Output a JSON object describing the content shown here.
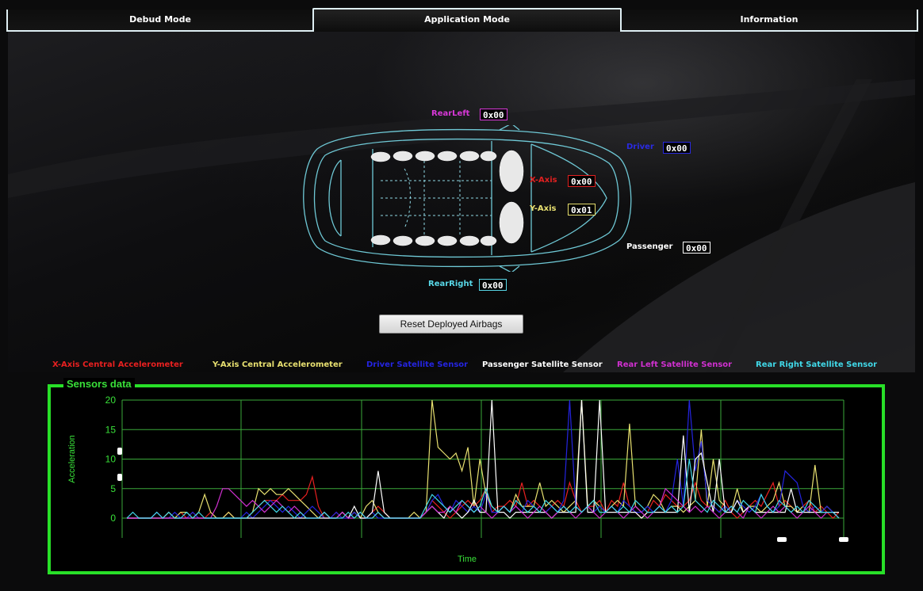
{
  "tabs": [
    {
      "label": "Debud Mode",
      "active": false
    },
    {
      "label": "Application Mode",
      "active": true
    },
    {
      "label": "Information",
      "active": false
    }
  ],
  "sensors": {
    "rear_left": {
      "label": "RearLeft",
      "value": "0x00",
      "color": "#d838d8"
    },
    "driver": {
      "label": "Driver",
      "value": "0x00",
      "color": "#2a2ae0"
    },
    "x_axis": {
      "label": "X-Axis",
      "value": "0x00",
      "color": "#e02020"
    },
    "y_axis": {
      "label": "Y-Axis",
      "value": "0x01",
      "color": "#e8e070"
    },
    "passenger": {
      "label": "Passenger",
      "value": "0x00",
      "color": "#ffffff"
    },
    "rear_right": {
      "label": "RearRight",
      "value": "0x00",
      "color": "#58d8e8"
    }
  },
  "reset_button_label": "Reset Deployed Airbags",
  "chart_title": "Sensors data",
  "chart_data": {
    "type": "line",
    "ylabel": "Acceleration",
    "xlabel": "Time",
    "ylim": [
      0,
      20
    ],
    "yticks": [
      0,
      5,
      10,
      15,
      20
    ],
    "grid": true,
    "legend": "top",
    "series": [
      {
        "name": "X-Axis Central Accelerometer",
        "color": "#e82020",
        "values": [
          0,
          0,
          0,
          0,
          0,
          1,
          0,
          1,
          0,
          1,
          0,
          1,
          0,
          0,
          1,
          0,
          0,
          1,
          0,
          0,
          0,
          1,
          2,
          3,
          3,
          3,
          4,
          3,
          3,
          3,
          4,
          7,
          2,
          0,
          0,
          1,
          0,
          0,
          1,
          0,
          0,
          1,
          2,
          1,
          0,
          0,
          0,
          0,
          0,
          0,
          1,
          3,
          2,
          1,
          0,
          1,
          2,
          3,
          2,
          3,
          5,
          1,
          2,
          2,
          3,
          2,
          6,
          2,
          3,
          2,
          1,
          2,
          3,
          2,
          6,
          3,
          1,
          2,
          2,
          3,
          1,
          3,
          2,
          6,
          2,
          1,
          0,
          1,
          3,
          2,
          4,
          3,
          2,
          2,
          3,
          6,
          3,
          2,
          2,
          1,
          3,
          1,
          0,
          1,
          2,
          3,
          2,
          4,
          6,
          2,
          3,
          2,
          1,
          2,
          3,
          1,
          2,
          1,
          0,
          1
        ]
      },
      {
        "name": "Y-Axis Central Accelerometer",
        "color": "#e8e070",
        "values": [
          0,
          0,
          0,
          0,
          0,
          0,
          0,
          1,
          0,
          1,
          1,
          0,
          1,
          4,
          1,
          0,
          0,
          1,
          0,
          0,
          0,
          1,
          5,
          4,
          5,
          4,
          4,
          5,
          4,
          3,
          2,
          1,
          0,
          1,
          0,
          0,
          1,
          0,
          1,
          0,
          2,
          3,
          1,
          0,
          0,
          0,
          0,
          0,
          1,
          0,
          1,
          20,
          12,
          11,
          10,
          11,
          8,
          12,
          2,
          10,
          4,
          2,
          1,
          2,
          1,
          4,
          2,
          2,
          2,
          6,
          2,
          3,
          2,
          1,
          2,
          3,
          20,
          2,
          3,
          2,
          1,
          2,
          3,
          2,
          16,
          2,
          1,
          2,
          4,
          3,
          1,
          2,
          2,
          1,
          2,
          3,
          15,
          2,
          10,
          3,
          2,
          1,
          5,
          1,
          2,
          2,
          1,
          2,
          3,
          6,
          2,
          2,
          1,
          2,
          1,
          9,
          1,
          2,
          1,
          0
        ]
      },
      {
        "name": "Driver Satellite Sensor",
        "color": "#2424e0",
        "values": [
          0,
          0,
          0,
          0,
          0,
          1,
          0,
          0,
          1,
          0,
          0,
          1,
          0,
          0,
          0,
          0,
          0,
          0,
          0,
          0,
          1,
          0,
          1,
          2,
          3,
          2,
          1,
          2,
          1,
          0,
          1,
          2,
          1,
          0,
          0,
          1,
          0,
          0,
          1,
          0,
          0,
          1,
          0,
          0,
          0,
          0,
          0,
          0,
          0,
          0,
          1,
          3,
          4,
          2,
          1,
          3,
          2,
          1,
          2,
          1,
          4,
          1,
          1,
          2,
          1,
          2,
          1,
          3,
          2,
          1,
          1,
          2,
          1,
          3,
          20,
          2,
          1,
          2,
          1,
          2,
          1,
          2,
          1,
          3,
          2,
          1,
          1,
          2,
          1,
          2,
          1,
          3,
          10,
          2,
          20,
          8,
          13,
          3,
          2,
          1,
          2,
          1,
          3,
          2,
          1,
          2,
          4,
          2,
          1,
          2,
          8,
          7,
          6,
          2,
          1,
          2,
          1,
          2,
          1,
          0
        ]
      },
      {
        "name": "Passenger Satellite Sensor",
        "color": "#ffffff",
        "values": [
          0,
          0,
          0,
          0,
          0,
          0,
          0,
          0,
          0,
          0,
          0,
          0,
          0,
          0,
          0,
          0,
          0,
          0,
          0,
          0,
          0,
          0,
          0,
          0,
          0,
          0,
          0,
          0,
          0,
          0,
          0,
          0,
          0,
          0,
          0,
          0,
          1,
          0,
          2,
          0,
          0,
          1,
          8,
          1,
          0,
          0,
          0,
          0,
          0,
          0,
          1,
          2,
          1,
          0,
          2,
          1,
          0,
          1,
          3,
          1,
          1,
          20,
          1,
          1,
          0,
          1,
          1,
          1,
          1,
          1,
          1,
          0,
          1,
          1,
          1,
          1,
          20,
          1,
          1,
          20,
          1,
          1,
          1,
          1,
          1,
          1,
          0,
          1,
          1,
          1,
          1,
          1,
          1,
          14,
          1,
          10,
          11,
          6,
          1,
          10,
          1,
          1,
          3,
          1,
          2,
          1,
          1,
          1,
          1,
          1,
          1,
          5,
          1,
          1,
          1,
          1,
          1,
          1,
          1,
          1
        ]
      },
      {
        "name": "Rear Left Satellite Sensor",
        "color": "#d030d0",
        "values": [
          0,
          0,
          0,
          0,
          0,
          0,
          0,
          0,
          0,
          0,
          0,
          0,
          0,
          0,
          0,
          2,
          5,
          5,
          4,
          3,
          2,
          3,
          2,
          1,
          2,
          3,
          2,
          1,
          2,
          1,
          0,
          0,
          0,
          1,
          0,
          0,
          1,
          0,
          0,
          1,
          0,
          0,
          1,
          0,
          0,
          0,
          0,
          0,
          0,
          0,
          1,
          2,
          1,
          1,
          2,
          1,
          3,
          2,
          1,
          2,
          1,
          0,
          1,
          2,
          1,
          2,
          1,
          0,
          1,
          2,
          1,
          0,
          1,
          2,
          1,
          0,
          1,
          2,
          1,
          0,
          1,
          2,
          1,
          0,
          1,
          2,
          1,
          0,
          1,
          2,
          5,
          4,
          3,
          2,
          1,
          2,
          1,
          2,
          1,
          0,
          1,
          2,
          1,
          0,
          2,
          1,
          0,
          1,
          2,
          1,
          2,
          1,
          0,
          1,
          2,
          1,
          0,
          1,
          1,
          0
        ]
      },
      {
        "name": "Rear Right Satellite Sensor",
        "color": "#40d8e8",
        "values": [
          0,
          1,
          0,
          0,
          0,
          1,
          0,
          1,
          0,
          0,
          1,
          0,
          1,
          0,
          0,
          0,
          0,
          0,
          0,
          0,
          0,
          1,
          2,
          3,
          2,
          1,
          2,
          1,
          0,
          1,
          0,
          0,
          0,
          1,
          0,
          0,
          0,
          1,
          0,
          1,
          0,
          0,
          1,
          0,
          0,
          0,
          0,
          0,
          0,
          0,
          2,
          4,
          3,
          2,
          1,
          2,
          3,
          2,
          1,
          2,
          5,
          2,
          1,
          2,
          1,
          3,
          2,
          1,
          2,
          1,
          3,
          2,
          1,
          2,
          1,
          2,
          1,
          2,
          3,
          1,
          1,
          2,
          1,
          2,
          1,
          3,
          2,
          1,
          1,
          2,
          1,
          2,
          1,
          2,
          10,
          3,
          2,
          1,
          3,
          2,
          1,
          2,
          1,
          3,
          2,
          1,
          4,
          2,
          1,
          3,
          2,
          1,
          2,
          1,
          3,
          2,
          1,
          1,
          1,
          0
        ]
      }
    ]
  }
}
